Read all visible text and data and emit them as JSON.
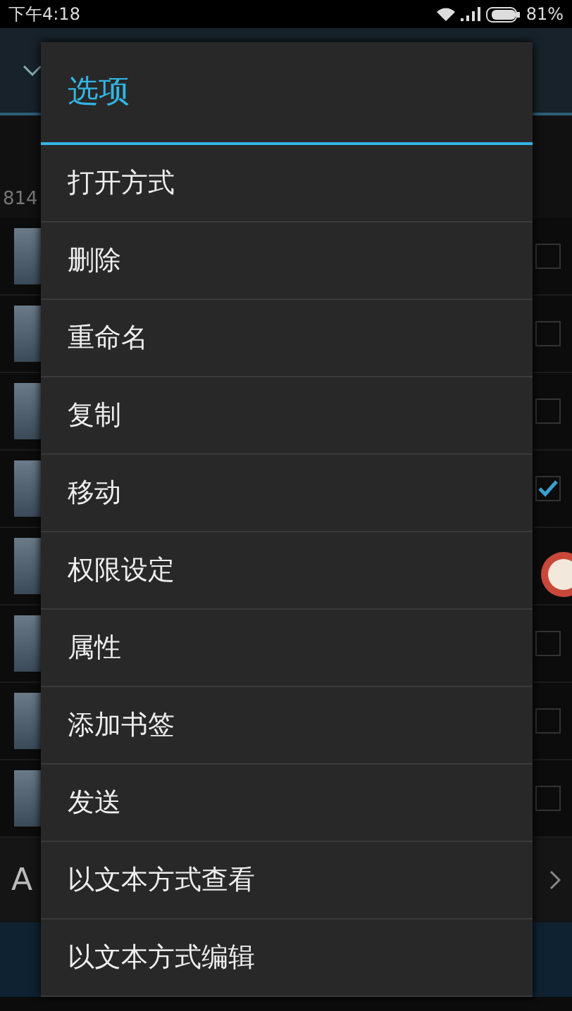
{
  "status_bar": {
    "time": "下午4:18",
    "battery": "81%"
  },
  "background": {
    "path_text": "814",
    "rows": [
      {
        "checked": false
      },
      {
        "checked": false
      },
      {
        "checked": false
      },
      {
        "checked": true
      },
      {},
      {
        "checked": false
      },
      {
        "checked": false
      },
      {
        "checked": false
      }
    ],
    "bottom_label": "A"
  },
  "dialog": {
    "title": "选项",
    "items": [
      {
        "label": "打开方式"
      },
      {
        "label": "删除"
      },
      {
        "label": "重命名"
      },
      {
        "label": "复制"
      },
      {
        "label": "移动"
      },
      {
        "label": "权限设定"
      },
      {
        "label": "属性"
      },
      {
        "label": "添加书签"
      },
      {
        "label": "发送"
      },
      {
        "label": "以文本方式查看"
      },
      {
        "label": "以文本方式编辑"
      }
    ]
  }
}
